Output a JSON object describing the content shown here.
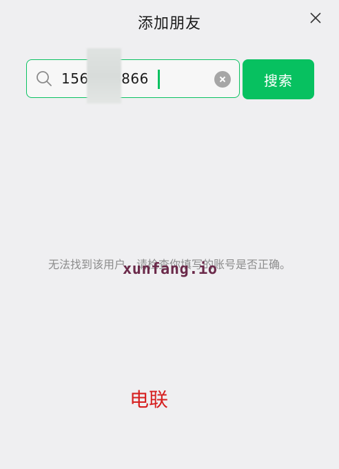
{
  "window": {
    "title": "添加朋友"
  },
  "search": {
    "value": "156     3866",
    "button_label": "搜索"
  },
  "result": {
    "message": "无法找到该用户，请检查你填写的账号是否正确。"
  },
  "watermarks": {
    "site": "xunfang.io",
    "label": "电联"
  },
  "icons": {
    "close": "close-icon",
    "search": "search-icon",
    "clear": "clear-icon"
  },
  "colors": {
    "accent": "#07c160",
    "background": "#efeff1",
    "hint_text": "#8c8c8c",
    "watermark_purple": "#6b2a4a",
    "watermark_red": "#d61f1f"
  }
}
